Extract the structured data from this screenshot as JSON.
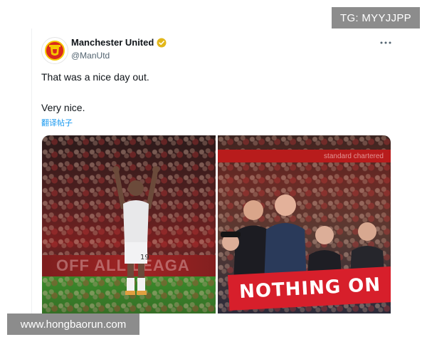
{
  "watermarks": {
    "top": "TG: MYYJJPP",
    "bottom": "www.hongbaorun.com"
  },
  "tweet": {
    "display_name": "Manchester United",
    "handle": "@ManUtd",
    "verified": true,
    "text_line1": "That was a nice day out.",
    "text_line2": "Very nice.",
    "translate_label": "翻译帖子",
    "more_icon": "more-horizontal-icon",
    "verified_icon": "verified-badge-icon",
    "accent_color": "#1d9bf0",
    "verified_color": "#e2b719"
  },
  "media": {
    "left_photo": {
      "board_text": "OFF ALL LEAGA",
      "shirt_number": "19"
    },
    "right_photo": {
      "banner_top_text": "standard chartered",
      "banner_bottom_text": "NOTHING ON"
    }
  }
}
